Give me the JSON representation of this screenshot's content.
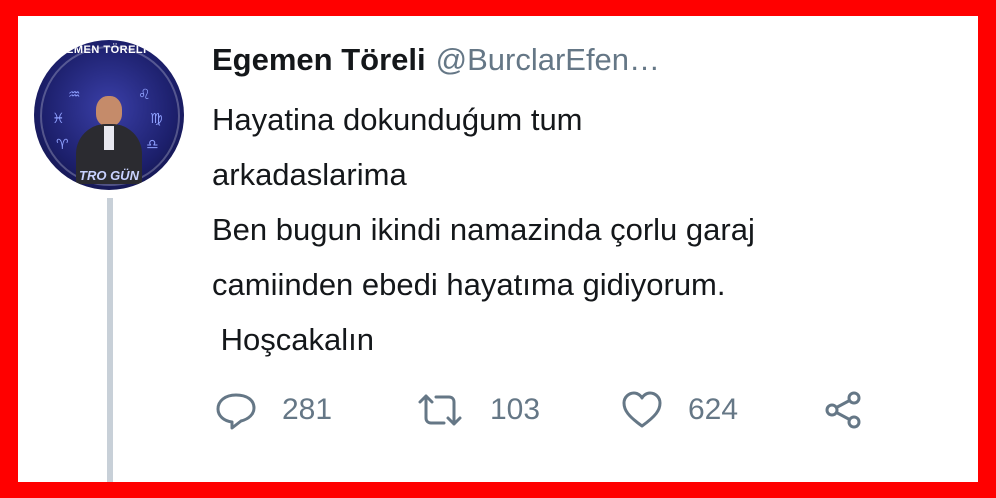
{
  "tweet": {
    "author_name": "Egemen Töreli",
    "author_handle": "@BurclarEfen…",
    "avatar_text_top": "EGEMEN TÖRELİ İLE",
    "avatar_text_bottom": "TRO GÜN",
    "text": "Hayatina dokunduǵum tum\narkadaslarima\nBen bugun ikindi namazinda çorlu garaj\ncamiinden ebedi hayatıma gidiyorum.\n Hoşcakalın",
    "replies": "281",
    "retweets": "103",
    "likes": "624"
  },
  "icons": {
    "reply": "reply-bubble-icon",
    "retweet": "retweet-icon",
    "like": "heart-icon",
    "share": "share-icon"
  },
  "colors": {
    "frame": "#ff0000",
    "text": "#14171a",
    "muted": "#657786",
    "thread_line": "#c8d0d8"
  }
}
